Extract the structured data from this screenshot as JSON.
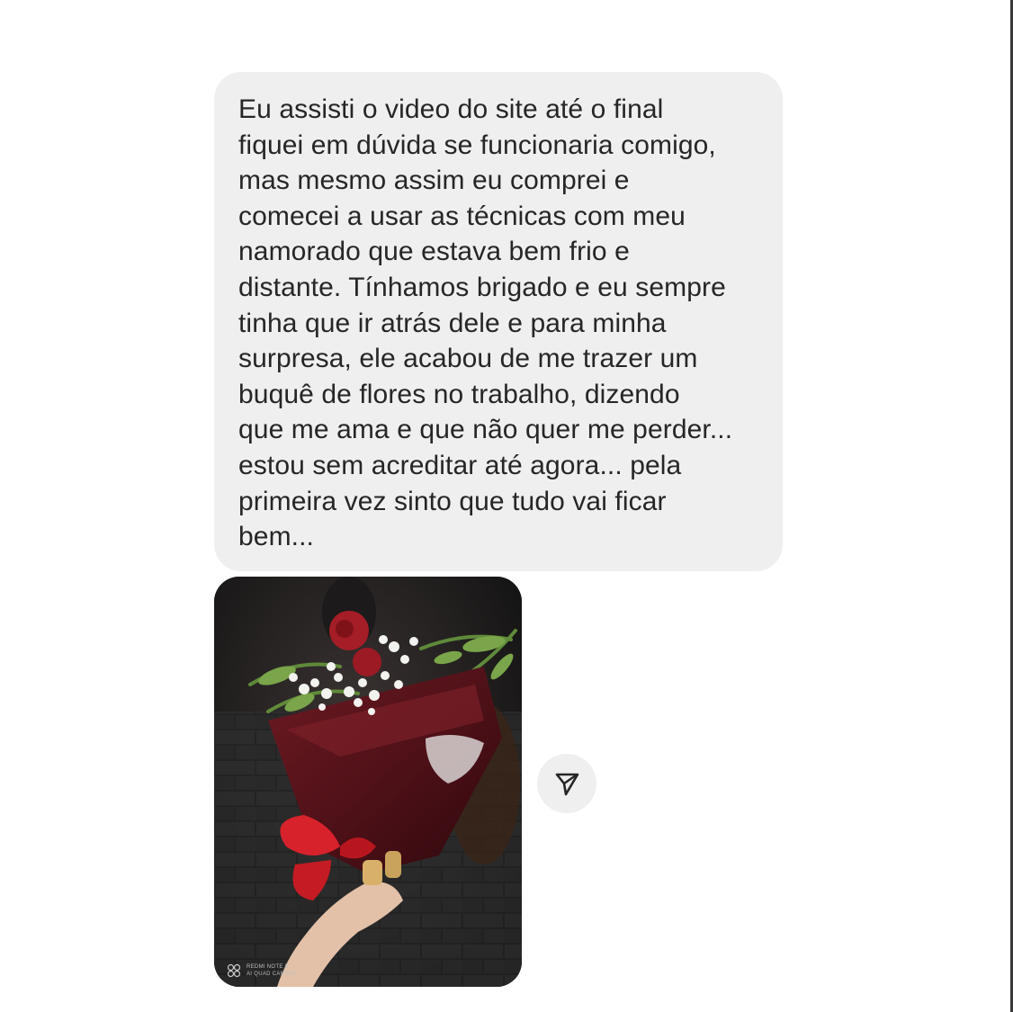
{
  "message": {
    "text": "Eu assisti o video do site até o final\nfiquei em dúvida se funcionaria comigo,\nmas mesmo assim eu comprei e\ncomecei a usar as técnicas com meu\nnamorado que estava bem frio e\ndistante. Tínhamos brigado e eu sempre\ntinha que ir atrás dele e para minha\nsurpresa, ele acabou de me trazer um\nbuquê de flores no trabalho, dizendo\nque me ama e que não quer me perder...\nestou sem acreditar até agora... pela\nprimeira vez sinto que tudo vai ficar\nbem...",
    "bubble_color": "#efefef",
    "text_color": "#262626"
  },
  "photo": {
    "watermark": "REDMI NOTE 8\nAI QUAD CAMERA"
  },
  "share_button": {
    "icon": "send-icon"
  }
}
